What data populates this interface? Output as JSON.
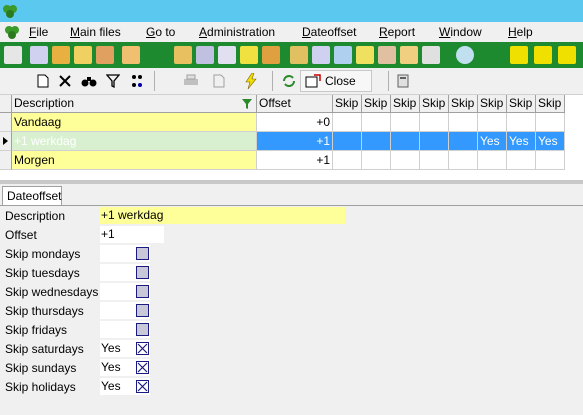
{
  "menu": {
    "items": [
      "File",
      "Main files",
      "Go to",
      "Administration",
      "Dateoffset",
      "Report",
      "Window",
      "Help"
    ]
  },
  "toolbar": {
    "close_label": "Close"
  },
  "grid": {
    "columns": [
      "Description",
      "Offset",
      "Skip",
      "Skip",
      "Skip",
      "Skip",
      "Skip",
      "Skip",
      "Skip",
      "Skip"
    ],
    "rows": [
      {
        "description": "Vandaag",
        "offset": "+0",
        "skips": [
          "",
          "",
          "",
          "",
          "",
          "",
          "",
          ""
        ]
      },
      {
        "description": "+1 werkdag",
        "offset": "+1",
        "skips": [
          "",
          "",
          "",
          "",
          "",
          "Yes",
          "Yes",
          "Yes"
        ]
      },
      {
        "description": "Morgen",
        "offset": "+1",
        "skips": [
          "",
          "",
          "",
          "",
          "",
          "",
          "",
          ""
        ]
      }
    ]
  },
  "tab": {
    "label": "Dateoffset"
  },
  "form": {
    "description_label": "Description",
    "description_value": "+1 werkdag",
    "offset_label": "Offset",
    "offset_value": "+1",
    "skips": [
      {
        "label": "Skip mondays",
        "value": "",
        "checked": false
      },
      {
        "label": "Skip tuesdays",
        "value": "",
        "checked": false
      },
      {
        "label": "Skip wednesdays",
        "value": "",
        "checked": false
      },
      {
        "label": "Skip thursdays",
        "value": "",
        "checked": false
      },
      {
        "label": "Skip fridays",
        "value": "",
        "checked": false
      },
      {
        "label": "Skip saturdays",
        "value": "Yes",
        "checked": true
      },
      {
        "label": "Skip sundays",
        "value": "Yes",
        "checked": true
      },
      {
        "label": "Skip holidays",
        "value": "Yes",
        "checked": true
      }
    ]
  },
  "colors": {
    "title_bar": "#5bc8f0",
    "toolbar_green": "#1e8a2f",
    "highlight_yellow": "#ffff99",
    "selected_blue": "#3399ff"
  }
}
